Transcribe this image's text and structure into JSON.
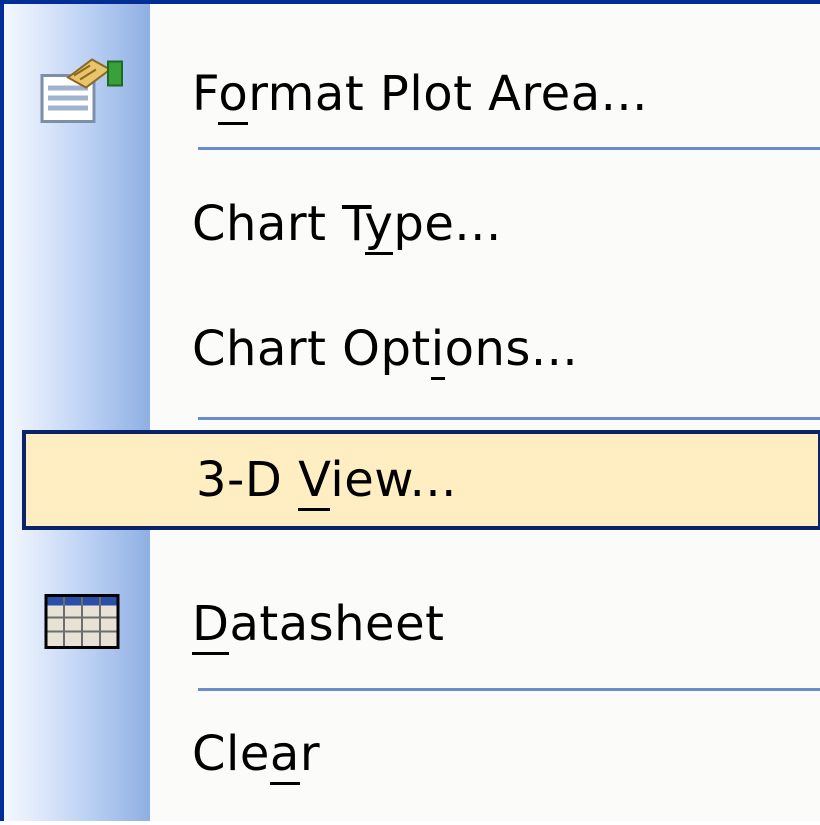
{
  "menu": {
    "items": [
      {
        "label_pre": "F",
        "label_u": "o",
        "label_post": "rmat Plot Area...",
        "icon": "format-plot-area-icon",
        "highlighted": false
      },
      {
        "label_pre": "Chart T",
        "label_u": "y",
        "label_post": "pe...",
        "icon": null,
        "highlighted": false
      },
      {
        "label_pre": "Chart Opt",
        "label_u": "i",
        "label_post": "ons...",
        "icon": null,
        "highlighted": false
      },
      {
        "label_pre": "3-D ",
        "label_u": "V",
        "label_post": "iew...",
        "icon": null,
        "highlighted": true
      },
      {
        "label_pre": "",
        "label_u": "D",
        "label_post": "atasheet",
        "icon": "datasheet-icon",
        "highlighted": false
      },
      {
        "label_pre": "Cle",
        "label_u": "a",
        "label_post": "r",
        "icon": null,
        "highlighted": false
      }
    ]
  },
  "colors": {
    "border": "#002d96",
    "highlight_bg": "#ffeec2",
    "highlight_border": "#0a246a",
    "separator": "#6a8cce"
  }
}
